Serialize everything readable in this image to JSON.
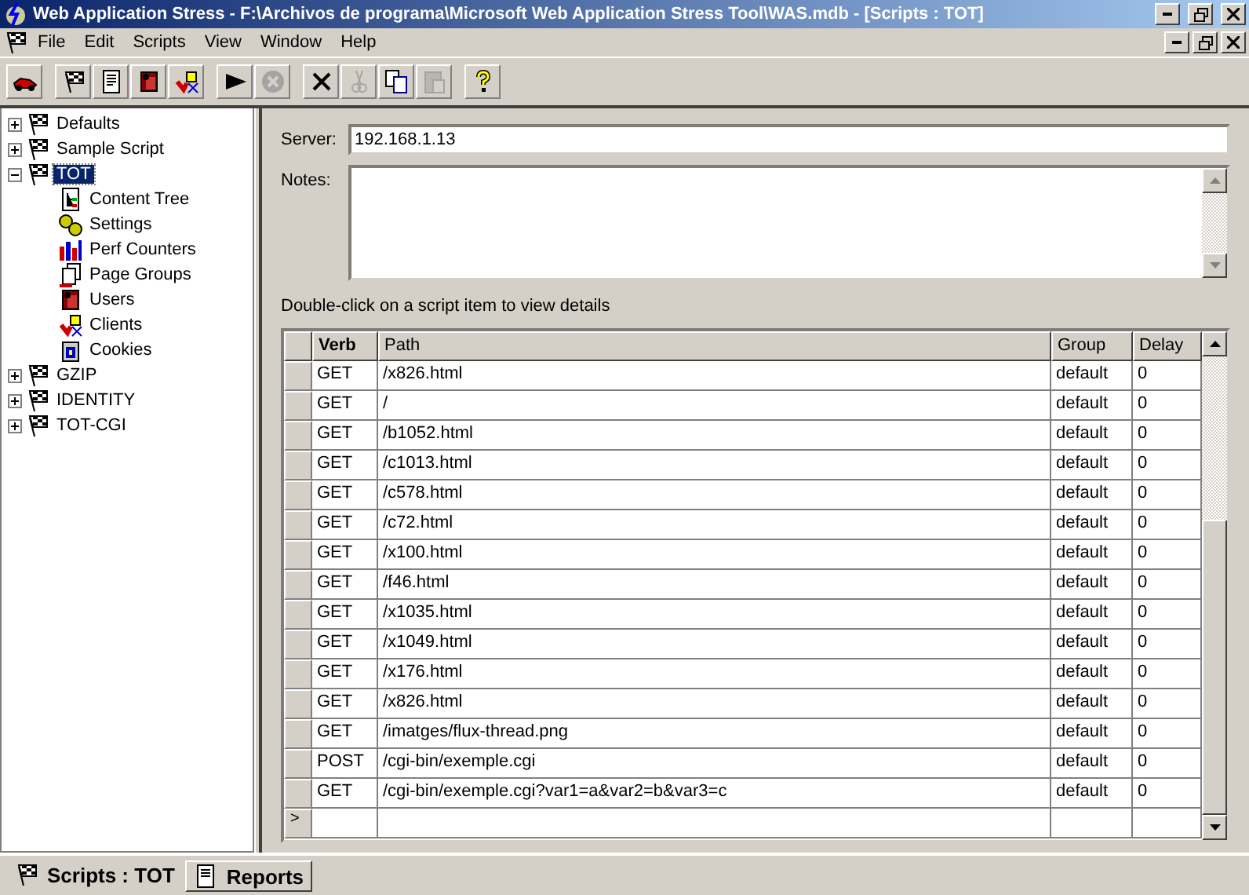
{
  "window": {
    "title": "Web Application Stress - F:\\Archivos de programa\\Microsoft Web Application Stress Tool\\WAS.mdb - [Scripts : TOT]"
  },
  "menu": [
    "File",
    "Edit",
    "Scripts",
    "View",
    "Window",
    "Help"
  ],
  "toolbar": [
    {
      "kind": "car",
      "disabled": false
    },
    {
      "kind": "sep"
    },
    {
      "kind": "flag",
      "disabled": false
    },
    {
      "kind": "doc",
      "disabled": false
    },
    {
      "kind": "users",
      "disabled": false
    },
    {
      "kind": "clients",
      "disabled": false
    },
    {
      "kind": "sep"
    },
    {
      "kind": "play",
      "disabled": false
    },
    {
      "kind": "stop",
      "disabled": true
    },
    {
      "kind": "sep"
    },
    {
      "kind": "delete",
      "disabled": false
    },
    {
      "kind": "cut",
      "disabled": true
    },
    {
      "kind": "copy",
      "disabled": false
    },
    {
      "kind": "paste",
      "disabled": true
    },
    {
      "kind": "sep"
    },
    {
      "kind": "help",
      "disabled": false
    }
  ],
  "tree": [
    {
      "label": "Defaults",
      "kind": "script",
      "expanded": false,
      "selected": false
    },
    {
      "label": "Sample Script",
      "kind": "script",
      "expanded": false,
      "selected": false
    },
    {
      "label": "TOT",
      "kind": "script",
      "expanded": true,
      "selected": true,
      "children": [
        {
          "label": "Content Tree",
          "kind": "tree",
          "selected": false
        },
        {
          "label": "Settings",
          "kind": "settings",
          "selected": false
        },
        {
          "label": "Perf Counters",
          "kind": "perf",
          "selected": false
        },
        {
          "label": "Page Groups",
          "kind": "groups",
          "selected": false
        },
        {
          "label": "Users",
          "kind": "users",
          "selected": false
        },
        {
          "label": "Clients",
          "kind": "clients",
          "selected": false
        },
        {
          "label": "Cookies",
          "kind": "cookies",
          "selected": false
        }
      ]
    },
    {
      "label": "GZIP",
      "kind": "script",
      "expanded": false,
      "selected": false
    },
    {
      "label": "IDENTITY",
      "kind": "script",
      "expanded": false,
      "selected": false
    },
    {
      "label": "TOT-CGI",
      "kind": "script",
      "expanded": false,
      "selected": false
    }
  ],
  "server": {
    "label": "Server:",
    "value": "192.168.1.13"
  },
  "notes": {
    "label": "Notes:"
  },
  "hint": "Double-click on a script item to view details",
  "table": {
    "columns": [
      "Verb",
      "Path",
      "Group",
      "Delay"
    ],
    "rows": [
      [
        "GET",
        "/x826.html",
        "default",
        "0"
      ],
      [
        "GET",
        "/",
        "default",
        "0"
      ],
      [
        "GET",
        "/b1052.html",
        "default",
        "0"
      ],
      [
        "GET",
        "/c1013.html",
        "default",
        "0"
      ],
      [
        "GET",
        "/c578.html",
        "default",
        "0"
      ],
      [
        "GET",
        "/c72.html",
        "default",
        "0"
      ],
      [
        "GET",
        "/x100.html",
        "default",
        "0"
      ],
      [
        "GET",
        "/f46.html",
        "default",
        "0"
      ],
      [
        "GET",
        "/x1035.html",
        "default",
        "0"
      ],
      [
        "GET",
        "/x1049.html",
        "default",
        "0"
      ],
      [
        "GET",
        "/x176.html",
        "default",
        "0"
      ],
      [
        "GET",
        "/x826.html",
        "default",
        "0"
      ],
      [
        "GET",
        "/imatges/flux-thread.png",
        "default",
        "0"
      ],
      [
        "POST",
        "/cgi-bin/exemple.cgi",
        "default",
        "0"
      ],
      [
        "GET",
        "/cgi-bin/exemple.cgi?var1=a&var2=b&var3=c",
        "default",
        "0"
      ]
    ],
    "new_row_marker": ">"
  },
  "tabs": [
    {
      "label": "Scripts : TOT",
      "kind": "scripts",
      "selected": true
    },
    {
      "label": "Reports",
      "kind": "reports",
      "selected": false
    }
  ]
}
